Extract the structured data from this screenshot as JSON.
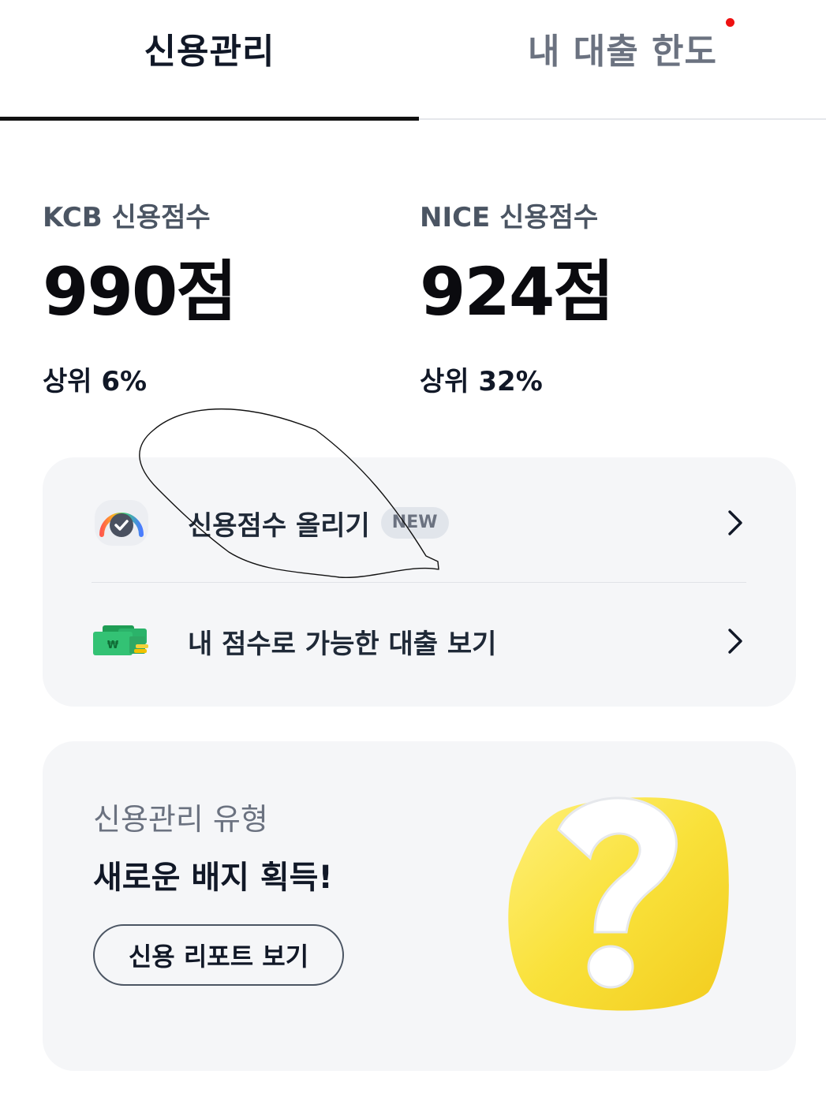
{
  "tabs": {
    "credit_management": "신용관리",
    "loan_limit": "내 대출 한도",
    "active": "credit_management"
  },
  "scores": {
    "kcb": {
      "label": "KCB 신용점수",
      "value": "990점",
      "rank": "상위 6%"
    },
    "nice": {
      "label": "NICE 신용점수",
      "value": "924점",
      "rank": "상위 32%"
    }
  },
  "menu": {
    "items": [
      {
        "label": "신용점수 올리기",
        "badge": "NEW",
        "icon": "gauge-icon"
      },
      {
        "label": "내 점수로 가능한 대출 보기",
        "icon": "money-stack-icon"
      }
    ]
  },
  "credit_type": {
    "subtitle": "신용관리 유형",
    "title": "새로운 배지 획득!",
    "button": "신용 리포트 보기",
    "art": "question-mark-icon"
  },
  "colors": {
    "accent_dark": "#111111",
    "notification_dot": "#ee1111",
    "card_bg": "#f5f6f8",
    "badge_bg": "#e1e5eb",
    "art_yellow": "#f9e13a"
  }
}
